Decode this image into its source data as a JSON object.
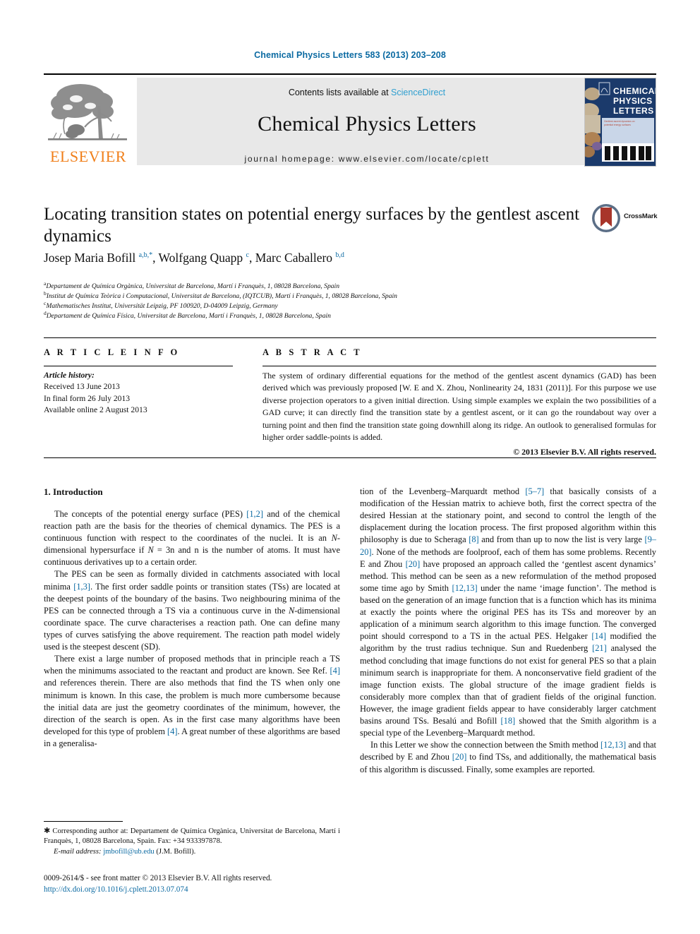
{
  "running_head": "Chemical Physics Letters 583 (2013) 203–208",
  "masthead": {
    "contents_prefix": "Contents lists available at ",
    "sciencedirect": "ScienceDirect",
    "journal_title": "Chemical Physics Letters",
    "homepage": "journal homepage: www.elsevier.com/locate/cplett",
    "publisher": "ELSEVIER",
    "cover_title_line1": "CHEMICAL",
    "cover_title_line2": "PHYSICS",
    "cover_title_line3": "LETTERS"
  },
  "title": "Locating transition states on potential energy surfaces by the gentlest ascent dynamics",
  "crossmark_label": "CrossMark",
  "authors_html": "Josep Maria Bofill <sup>a,b,*</sup>, Wolfgang Quapp <sup>c</sup>, Marc Caballero <sup>b,d</sup>",
  "affiliations": [
    "Departament de Química Orgànica, Universitat de Barcelona, Martí i Franquès, 1, 08028 Barcelona, Spain",
    "Institut de Química Teòrica i Computacional, Universitat de Barcelona, (IQTCUB), Martí i Franquès, 1, 08028 Barcelona, Spain",
    "Mathematisches Institut, Universität Leipzig, PF 100920, D-04009 Leipzig, Germany",
    "Departament de Química Física, Universitat de Barcelona, Martí i Franquès, 1, 08028 Barcelona, Spain"
  ],
  "affiliation_marks": [
    "a",
    "b",
    "c",
    "d"
  ],
  "headings": {
    "article_info": "A R T I C L E   I N F O",
    "abstract": "A B S T R A C T"
  },
  "article_history": {
    "label": "Article history:",
    "received": "Received 13 June 2013",
    "final_form": "In final form 26 July 2013",
    "available_online": "Available online 2 August 2013"
  },
  "abstract_text": "The system of ordinary differential equations for the method of the gentlest ascent dynamics (GAD) has been derived which was previously proposed [W. E and X. Zhou, Nonlinearity 24, 1831 (2011)]. For this purpose we use diverse projection operators to a given initial direction. Using simple examples we explain the two possibilities of a GAD curve; it can directly find the transition state by a gentlest ascent, or it can go the roundabout way over a turning point and then find the transition state going downhill along its ridge. An outlook to generalised formulas for higher order saddle-points is added.",
  "copyright_line": "© 2013 Elsevier B.V. All rights reserved.",
  "body": {
    "section_number_title": "1. Introduction",
    "left_paragraphs": [
      "The concepts of the potential energy surface (PES) <span class=\"ref\">[1,2]</span> and of the chemical reaction path are the basis for the theories of chemical dynamics. The PES is a continuous function with respect to the coordinates of the nuclei. It is an <em>N</em>-dimensional hypersurface if <em>N</em> = 3n and n is the number of atoms. It must have continuous derivatives up to a certain order.",
      "The PES can be seen as formally divided in catchments associated with local minima <span class=\"ref\">[1,3]</span>. The first order saddle points or transition states (TSs) are located at the deepest points of the boundary of the basins. Two neighbouring minima of the PES can be connected through a TS via a continuous curve in the <em>N</em>-dimensional coordinate space. The curve characterises a reaction path. One can define many types of curves satisfying the above requirement. The reaction path model widely used is the steepest descent (SD).",
      "There exist a large number of proposed methods that in principle reach a TS when the minimums associated to the reactant and product are known. See Ref. <span class=\"ref\">[4]</span> and references therein. There are also methods that find the TS when only one minimum is known. In this case, the problem is much more cumbersome because the initial data are just the geometry coordinates of the minimum, however, the direction of the search is open. As in the first case many algorithms have been developed for this type of problem <span class=\"ref\">[4]</span>. A great number of these algorithms are based in a generalisa-"
    ],
    "right_paragraphs": [
      "tion of the Levenberg–Marquardt method <span class=\"ref\">[5–7]</span> that basically consists of a modification of the Hessian matrix to achieve both, first the correct spectra of the desired Hessian at the stationary point, and second to control the length of the displacement during the location process. The first proposed algorithm within this philosophy is due to Scheraga <span class=\"ref\">[8]</span> and from than up to now the list is very large <span class=\"ref\">[9–20]</span>. None of the methods are foolproof, each of them has some problems. Recently E and Zhou <span class=\"ref\">[20]</span> have proposed an approach called the ‘gentlest ascent dynamics’ method. This method can be seen as a new reformulation of the method proposed some time ago by Smith <span class=\"ref\">[12,13]</span> under the name ‘image function’. The method is based on the generation of an image function that is a function which has its minima at exactly the points where the original PES has its TSs and moreover by an application of a minimum search algorithm to this image function. The converged point should correspond to a TS in the actual PES. Helgaker <span class=\"ref\">[14]</span> modified the algorithm by the trust radius technique. Sun and Ruedenberg <span class=\"ref\">[21]</span> analysed the method concluding that image functions do not exist for general PES so that a plain minimum search is inappropriate for them. A nonconservative field gradient of the image function exists. The global structure of the image gradient fields is considerably more complex than that of gradient fields of the original function. However, the image gradient fields appear to have considerably larger catchment basins around TSs. Besalú and Bofill <span class=\"ref\">[18]</span> showed that the Smith algorithm is a special type of the Levenberg–Marquardt method.",
      "In this Letter we show the connection between the Smith method <span class=\"ref\">[12,13]</span> and that described by E and Zhou <span class=\"ref\">[20]</span> to find TSs, and additionally, the mathematical basis of this algorithm is discussed. Finally, some examples are reported."
    ]
  },
  "footnote": {
    "corresponding_html": "<span class=\"star\">✱</span> Corresponding author at: Departament de Química Orgànica, Universitat de Barcelona, Martí i Franquès, 1, 08028 Barcelona, Spain. Fax: +34 933397878.",
    "email_label": "E-mail address:",
    "email": "jmbofill@ub.edu",
    "email_owner": "(J.M. Bofill)."
  },
  "footer": {
    "issn_line": "0009-2614/$ - see front matter © 2013 Elsevier B.V. All rights reserved.",
    "doi": "http://dx.doi.org/10.1016/j.cplett.2013.07.074"
  },
  "colors": {
    "link_blue": "#0b6aa2",
    "sciencedirect_blue": "#2f9fd0",
    "elsevier_orange": "#f07f1a",
    "band_gray": "#e8e8e8",
    "cover_navy": "#1b3a6b",
    "crossmark_red": "#a8352a"
  }
}
